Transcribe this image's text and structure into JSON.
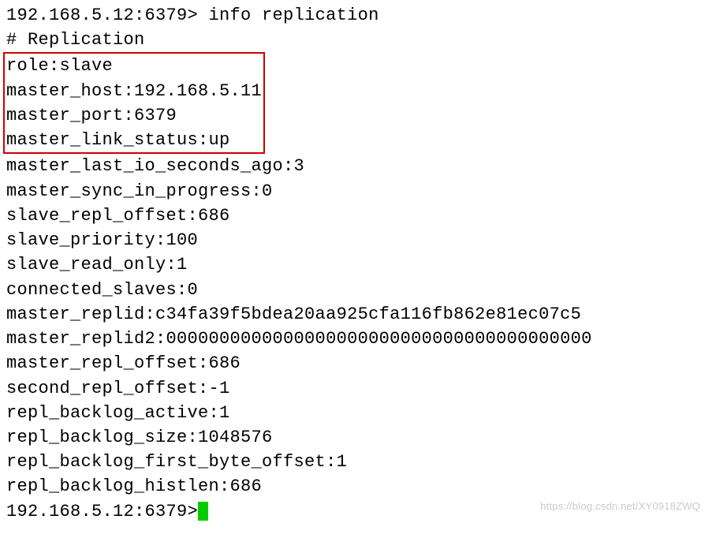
{
  "terminal": {
    "prompt1": "192.168.5.12:6379> ",
    "command": "info replication",
    "header": "# Replication",
    "highlighted": [
      "role:slave",
      "master_host:192.168.5.11",
      "master_port:6379",
      "master_link_status:up"
    ],
    "lines": [
      "master_last_io_seconds_ago:3",
      "master_sync_in_progress:0",
      "slave_repl_offset:686",
      "slave_priority:100",
      "slave_read_only:1",
      "connected_slaves:0",
      "master_replid:c34fa39f5bdea20aa925cfa116fb862e81ec07c5",
      "master_replid2:0000000000000000000000000000000000000000",
      "master_repl_offset:686",
      "second_repl_offset:-1",
      "repl_backlog_active:1",
      "repl_backlog_size:1048576",
      "repl_backlog_first_byte_offset:1",
      "repl_backlog_histlen:686"
    ],
    "prompt2": "192.168.5.12:6379> "
  },
  "watermark": "https://blog.csdn.net/XY0918ZWQ"
}
